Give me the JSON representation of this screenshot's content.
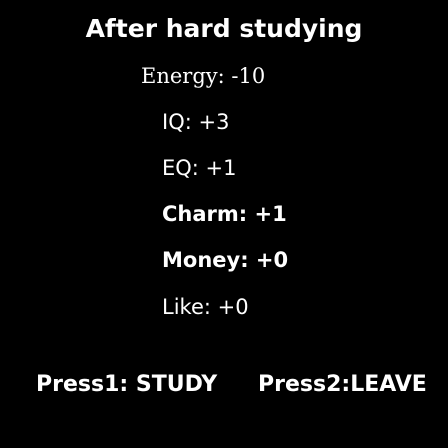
{
  "title": "After hard studying",
  "stats": {
    "energy": "Energy: -10",
    "iq": "IQ: +3",
    "eq": "EQ: +1",
    "charm": "Charm: +1",
    "money": "Money: +0",
    "like": "Like: +0"
  },
  "options": {
    "study": "Press1: STUDY",
    "leave": "Press2:LEAVE"
  },
  "colors": {
    "background": "#000000",
    "text": "#ffffff"
  }
}
